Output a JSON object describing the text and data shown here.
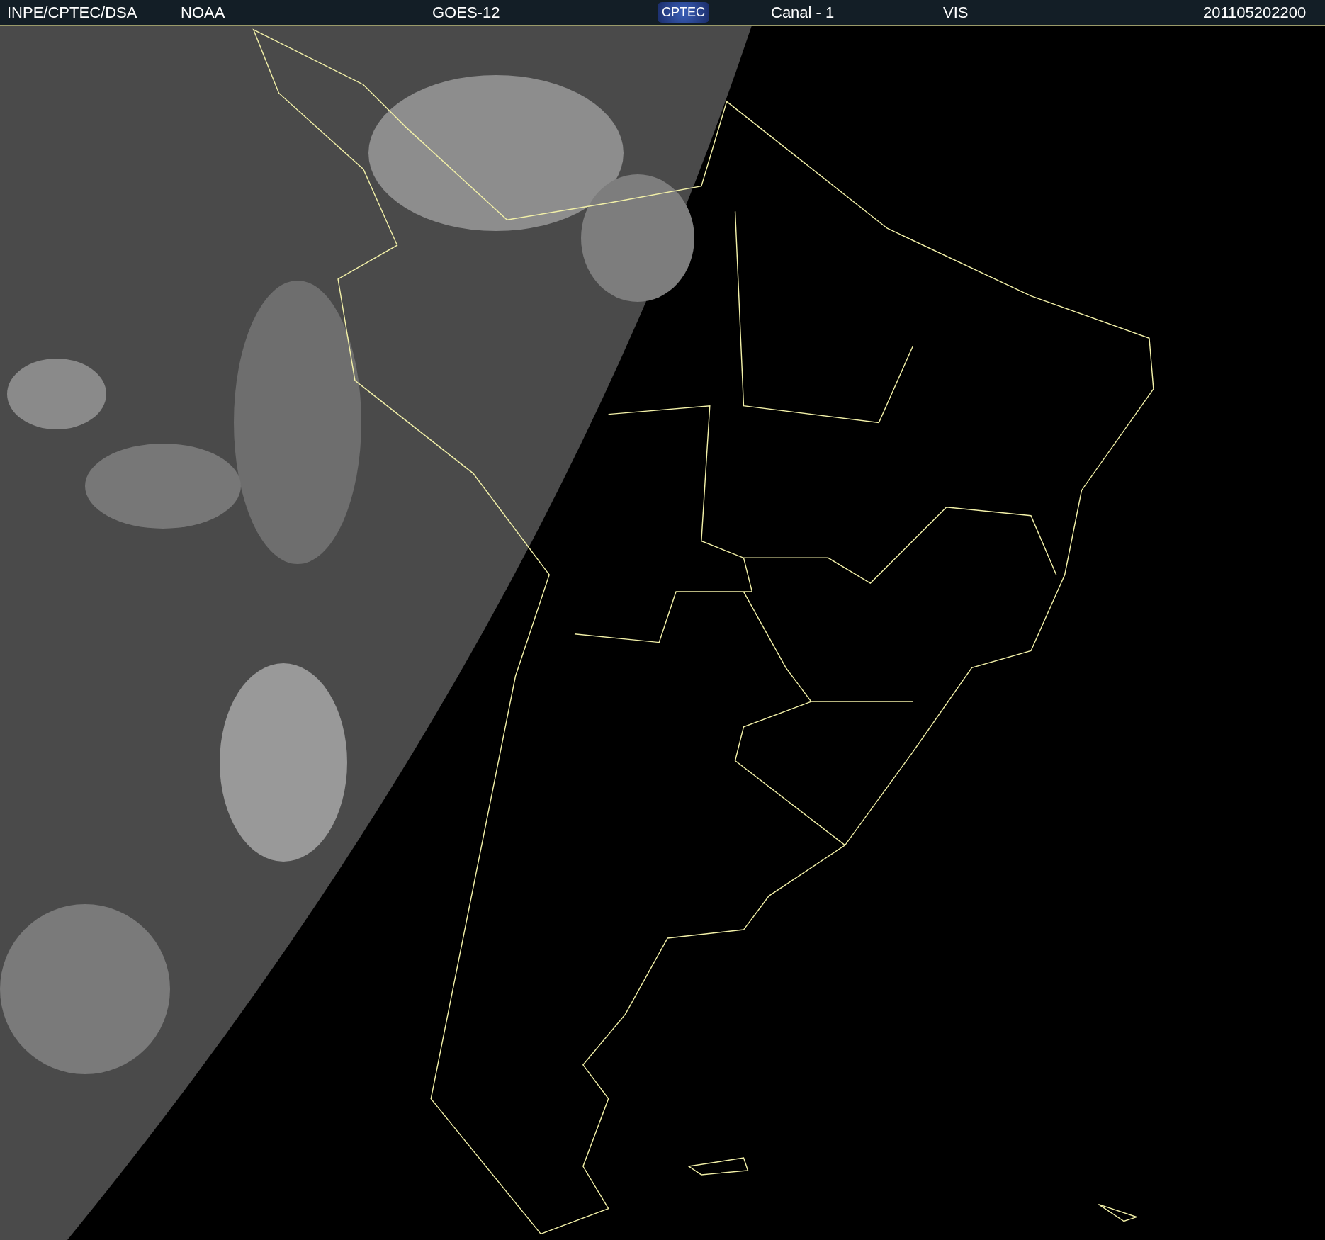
{
  "header": {
    "items": [
      {
        "kind": "text",
        "text": "INPE/CPTEC/DSA"
      },
      {
        "kind": "text",
        "text": "NOAA"
      },
      {
        "kind": "text",
        "text": "GOES-12"
      },
      {
        "kind": "logo",
        "text": "CPTEC"
      },
      {
        "kind": "text",
        "text": "Canal - 1"
      },
      {
        "kind": "text",
        "text": "VIS"
      },
      {
        "kind": "text",
        "text": "201105202200"
      }
    ]
  }
}
